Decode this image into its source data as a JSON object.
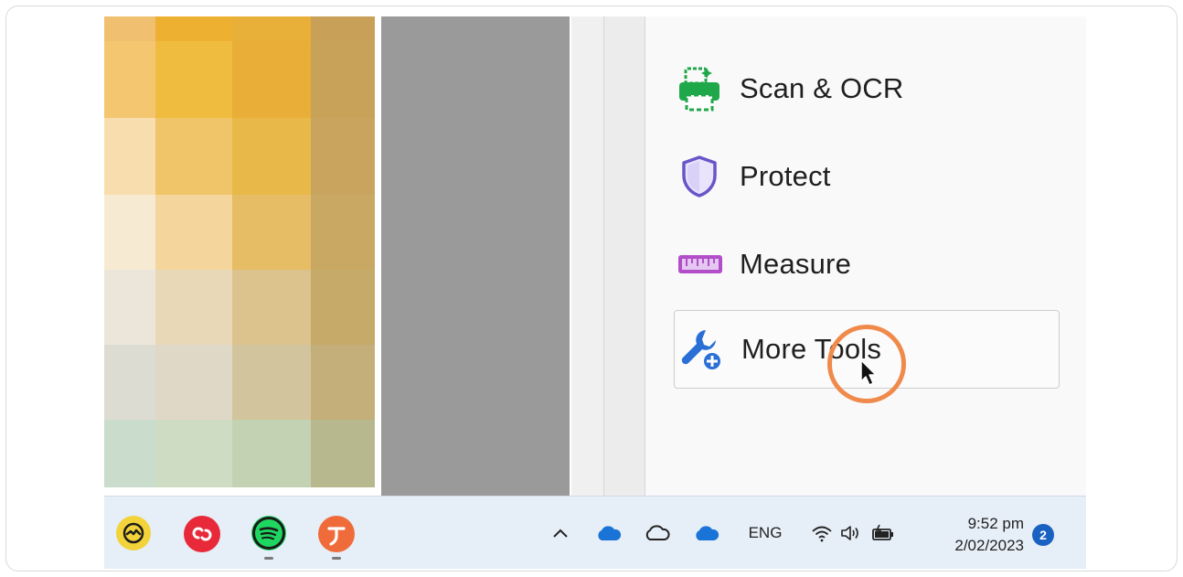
{
  "pixel_colors": [
    [
      "#f0c070",
      "#eeb030",
      "#e8b038",
      "#c8a058"
    ],
    [
      "#f4c670",
      "#f0bc40",
      "#e8ae38",
      "#c8a258"
    ],
    [
      "#f8deae",
      "#f0c468",
      "#e8b848",
      "#c8a45e"
    ],
    [
      "#f6ead2",
      "#f4d69c",
      "#e6bc64",
      "#c8a862"
    ],
    [
      "#ece6da",
      "#e8d8b8",
      "#dcc28c",
      "#c6aa6a"
    ],
    [
      "#dcdcd2",
      "#e0d8c6",
      "#d2c49c",
      "#c4ae7a"
    ],
    [
      "#cadccc",
      "#cedcc4",
      "#c4d2b4",
      "#b8b88e"
    ]
  ],
  "tools": [
    {
      "label": "Scan & OCR",
      "icon": "scan-ocr-icon"
    },
    {
      "label": "Protect",
      "icon": "shield-icon"
    },
    {
      "label": "Measure",
      "icon": "ruler-icon"
    },
    {
      "label": "More Tools",
      "icon": "more-tools-icon"
    }
  ],
  "taskbar": {
    "apps": [
      {
        "name": "basecamp",
        "icon": "basecamp-icon",
        "color": "#f3d33a"
      },
      {
        "name": "creative-cloud",
        "icon": "creative-cloud-icon",
        "color": "#e8293a"
      },
      {
        "name": "spotify",
        "icon": "spotify-icon",
        "color": "#1ed760"
      },
      {
        "name": "typora",
        "icon": "typora-icon",
        "color": "#f06b3a"
      }
    ],
    "language": "ENG",
    "time": "9:52 pm",
    "date": "2/02/2023",
    "notification_count": "2"
  },
  "accent_colors": {
    "scan_icon": "#1fa84a",
    "protect_icon": "#6a55c8",
    "measure_icon": "#b24fc8",
    "more_tools_icon": "#2a6fd6",
    "cursor_ring": "#f08a4b",
    "onedrive_blue": "#1a73d6"
  }
}
